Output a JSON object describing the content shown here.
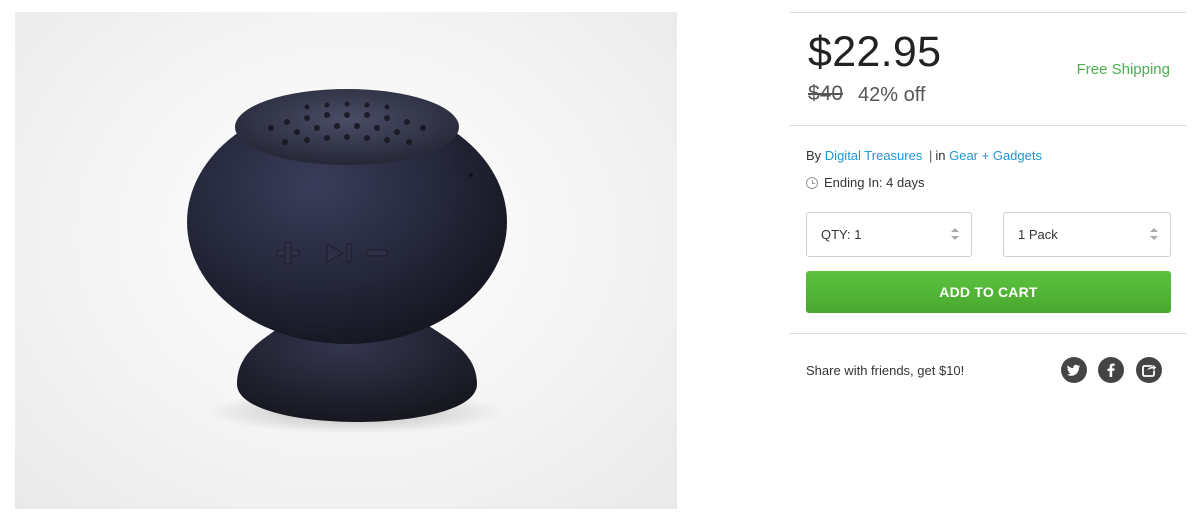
{
  "product": {
    "image_alt": "Black suction-cup bluetooth speaker"
  },
  "pricing": {
    "price": "$22.95",
    "original_price": "$40",
    "discount": "42% off",
    "shipping": "Free Shipping"
  },
  "seller": {
    "by_label": "By",
    "vendor": "Digital Treasures",
    "separator": "|",
    "in_label": "in",
    "category": "Gear + Gadgets"
  },
  "deal": {
    "ending": "Ending In: 4 days"
  },
  "options": {
    "quantity": "QTY: 1",
    "pack": "1 Pack"
  },
  "cart": {
    "add_label": "ADD TO CART"
  },
  "share": {
    "text": "Share with friends, get $10!",
    "icons": [
      "twitter-icon",
      "facebook-icon",
      "share-icon"
    ]
  },
  "colors": {
    "accent_green": "#4caf50",
    "button_green": "#52b536",
    "link_blue": "#2196d3",
    "social_gray": "#444444"
  }
}
